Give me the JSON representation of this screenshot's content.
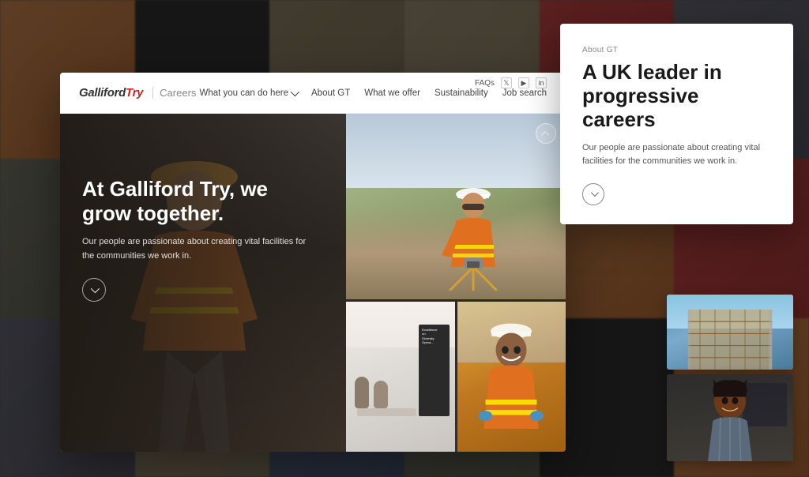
{
  "bg": {
    "cells": [
      "worker",
      "dark",
      "site",
      "site2",
      "red",
      "person",
      "person2",
      "blue",
      "warm",
      "dark2",
      "site3",
      "person3"
    ]
  },
  "navbar": {
    "logo": "GallifordTry",
    "logo_part1": "Galliford",
    "logo_part2": "Try",
    "careers": "Careers",
    "faqs": "FAQs",
    "nav_links": [
      {
        "label": "What you can do here",
        "has_dropdown": true
      },
      {
        "label": "About GT",
        "has_dropdown": false
      },
      {
        "label": "What we offer",
        "has_dropdown": false
      },
      {
        "label": "Sustainability",
        "has_dropdown": false
      },
      {
        "label": "Job search",
        "has_dropdown": false
      }
    ]
  },
  "hero": {
    "title": "At Galliford Try, we grow together.",
    "subtitle": "Our people are passionate about creating vital facilities for the communities we work in."
  },
  "about_panel": {
    "eyebrow": "About GT",
    "title": "A UK leader in progressive careers",
    "body": "Our people are passionate about creating vital facilities for the communities we work in."
  },
  "photos": {
    "top_alt": "Surveyor with theodolite",
    "bottom_left_alt": "Team meeting",
    "bottom_right_alt": "Worker in hi-vis",
    "building_alt": "Building under construction",
    "person_alt": "Portrait of a professional"
  },
  "icons": {
    "twitter": "𝕏",
    "youtube": "▶",
    "linkedin": "in"
  }
}
